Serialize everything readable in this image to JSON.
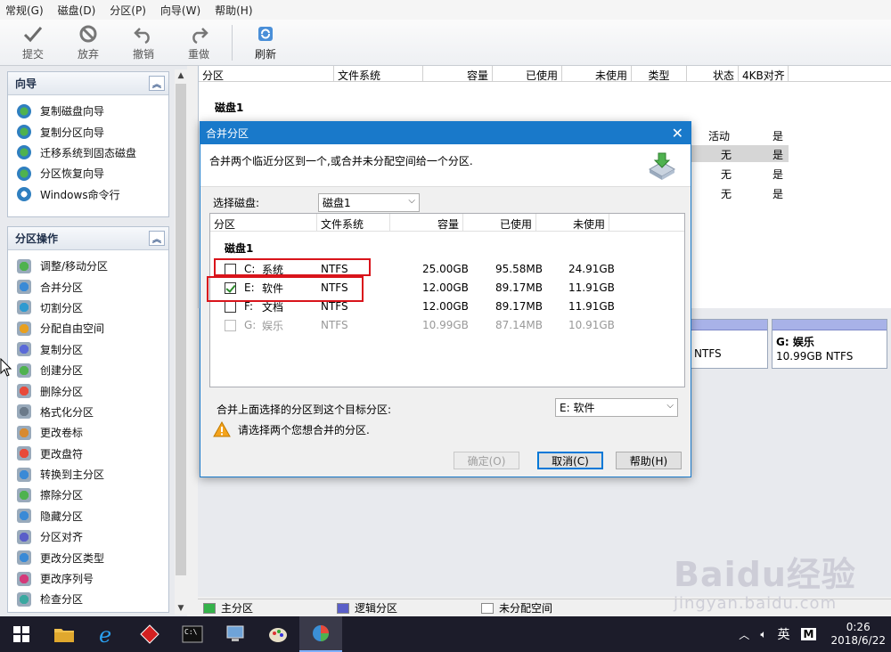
{
  "menu": [
    "常规(G)",
    "磁盘(D)",
    "分区(P)",
    "向导(W)",
    "帮助(H)"
  ],
  "toolbar": {
    "submit": "提交",
    "discard": "放弃",
    "undo": "撤销",
    "redo": "重做",
    "refresh": "刷新"
  },
  "wizard_group": {
    "title": "向导",
    "items": [
      "复制磁盘向导",
      "复制分区向导",
      "迁移系统到固态磁盘",
      "分区恢复向导",
      "Windows命令行"
    ]
  },
  "ops_group": {
    "title": "分区操作",
    "items": [
      "调整/移动分区",
      "合并分区",
      "切割分区",
      "分配自由空间",
      "复制分区",
      "创建分区",
      "删除分区",
      "格式化分区",
      "更改卷标",
      "更改盘符",
      "转换到主分区",
      "擦除分区",
      "隐藏分区",
      "分区对齐",
      "更改分区类型",
      "更改序列号",
      "检查分区"
    ]
  },
  "main_table": {
    "headers": [
      "分区",
      "文件系统",
      "容量",
      "已使用",
      "未使用",
      "类型",
      "状态",
      "4KB对齐"
    ],
    "disk_label": "磁盘1",
    "rows": [
      {
        "status": "活动",
        "align": "是"
      },
      {
        "status": "无",
        "align": "是"
      },
      {
        "status": "无",
        "align": "是"
      },
      {
        "status": "无",
        "align": "是"
      }
    ]
  },
  "diskmap": {
    "partial_label": "B NTFS",
    "g_name": "G: 娱乐",
    "g_info": "10.99GB NTFS"
  },
  "legend": [
    "主分区",
    "逻辑分区",
    "未分配空间"
  ],
  "dialog": {
    "title": "合并分区",
    "description": "合并两个临近分区到一个,或合并未分配空间给一个分区.",
    "select_disk_label": "选择磁盘:",
    "select_disk_value": "磁盘1",
    "headers": [
      "分区",
      "文件系统",
      "容量",
      "已使用",
      "未使用"
    ],
    "disk_label": "磁盘1",
    "rows": [
      {
        "drive": "C:",
        "name": "系统",
        "fs": "NTFS",
        "cap": "25.00GB",
        "used": "95.58MB",
        "free": "24.91GB",
        "checked": false,
        "enabled": true
      },
      {
        "drive": "E:",
        "name": "软件",
        "fs": "NTFS",
        "cap": "12.00GB",
        "used": "89.17MB",
        "free": "11.91GB",
        "checked": true,
        "enabled": true
      },
      {
        "drive": "F:",
        "name": "文档",
        "fs": "NTFS",
        "cap": "12.00GB",
        "used": "89.17MB",
        "free": "11.91GB",
        "checked": false,
        "enabled": true
      },
      {
        "drive": "G:",
        "name": "娱乐",
        "fs": "NTFS",
        "cap": "10.99GB",
        "used": "87.14MB",
        "free": "10.91GB",
        "checked": false,
        "enabled": false
      }
    ],
    "target_label": "合并上面选择的分区到这个目标分区:",
    "target_value": "E: 软件",
    "warning": "请选择两个您想合并的分区.",
    "ok": "确定(O)",
    "cancel": "取消(C)",
    "help": "帮助(H)"
  },
  "tray": {
    "ime": "英",
    "ime2": "M",
    "time": "0:26",
    "date": "2018/6/22"
  },
  "watermark": {
    "brand": "Baidu经验",
    "url": "jingyan.baidu.com"
  },
  "colors": {
    "accent": "#1979ca",
    "highlight_box": "#d9141b",
    "primary_partition": "#34b24a",
    "logical_partition": "#5a5fc8"
  }
}
